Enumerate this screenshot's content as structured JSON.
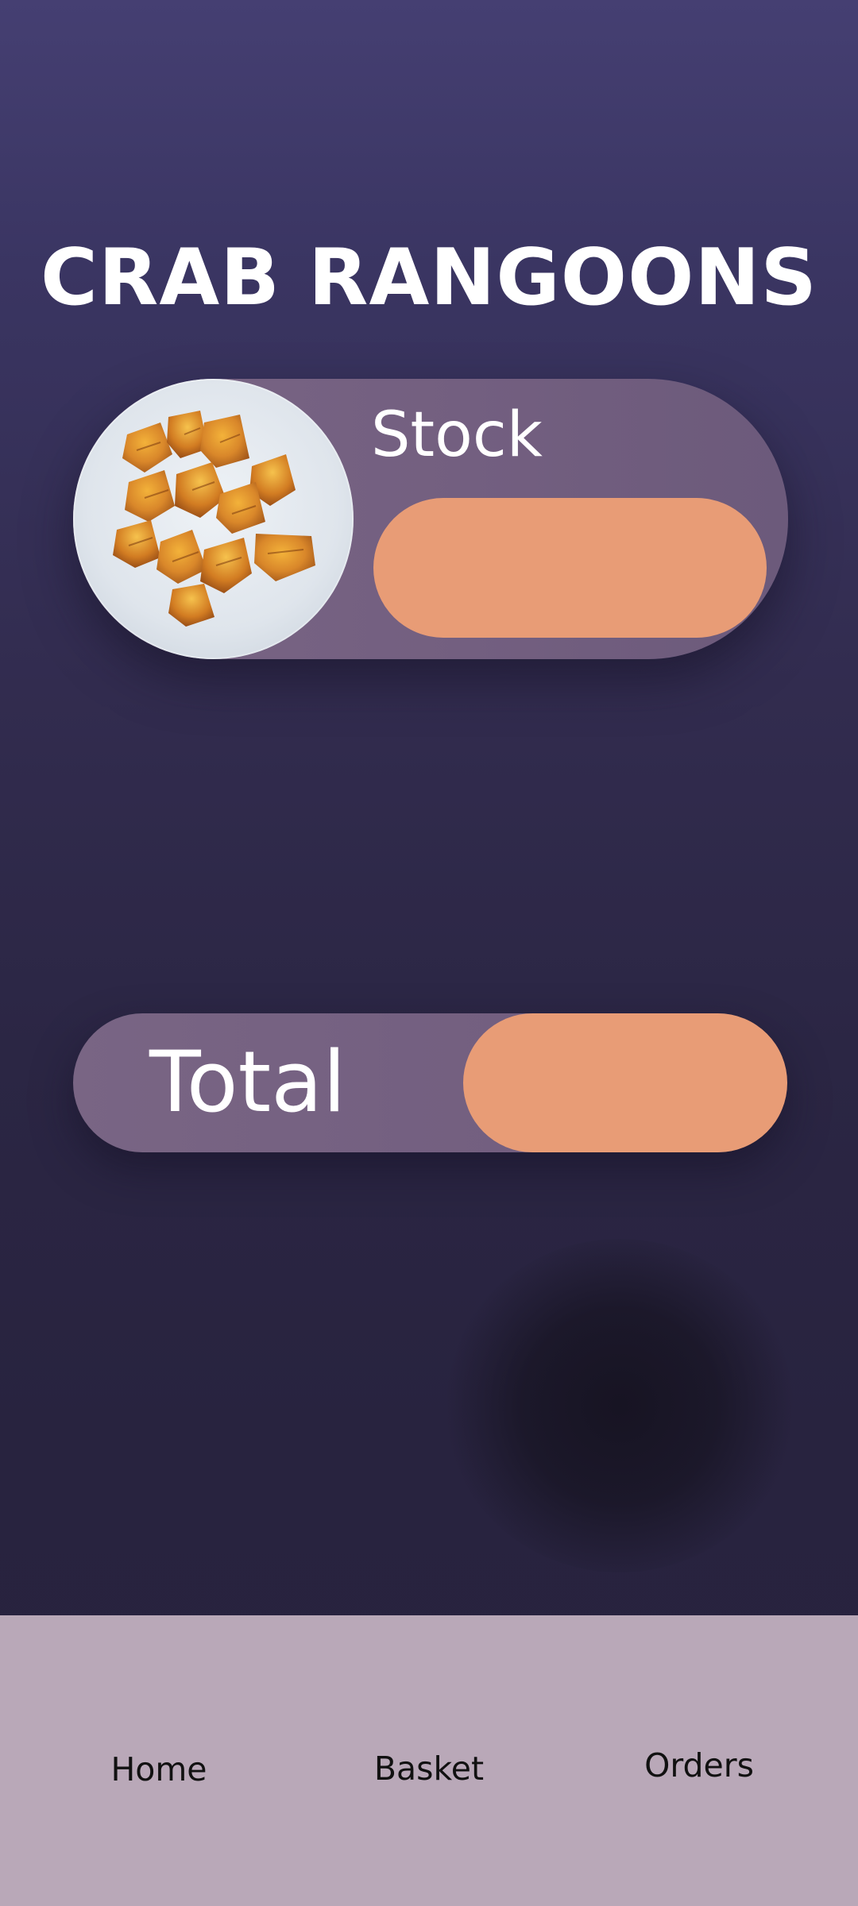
{
  "header": {
    "title": "CRAB RANGOONS"
  },
  "product": {
    "image_icon": "crab-rangoon-plate-image",
    "stock_label": "Stock",
    "stock_value": ""
  },
  "total": {
    "label": "Total",
    "value": ""
  },
  "nav": {
    "items": [
      {
        "label": "Home"
      },
      {
        "label": "Basket"
      },
      {
        "label": "Orders"
      }
    ]
  },
  "colors": {
    "background_top": "#453f72",
    "background_bottom": "#27223e",
    "card": "#796584",
    "accent_pill": "#e89c76",
    "nav_bar": "#b9a8b8",
    "title_text": "#ffffff",
    "nav_text": "#111111"
  }
}
